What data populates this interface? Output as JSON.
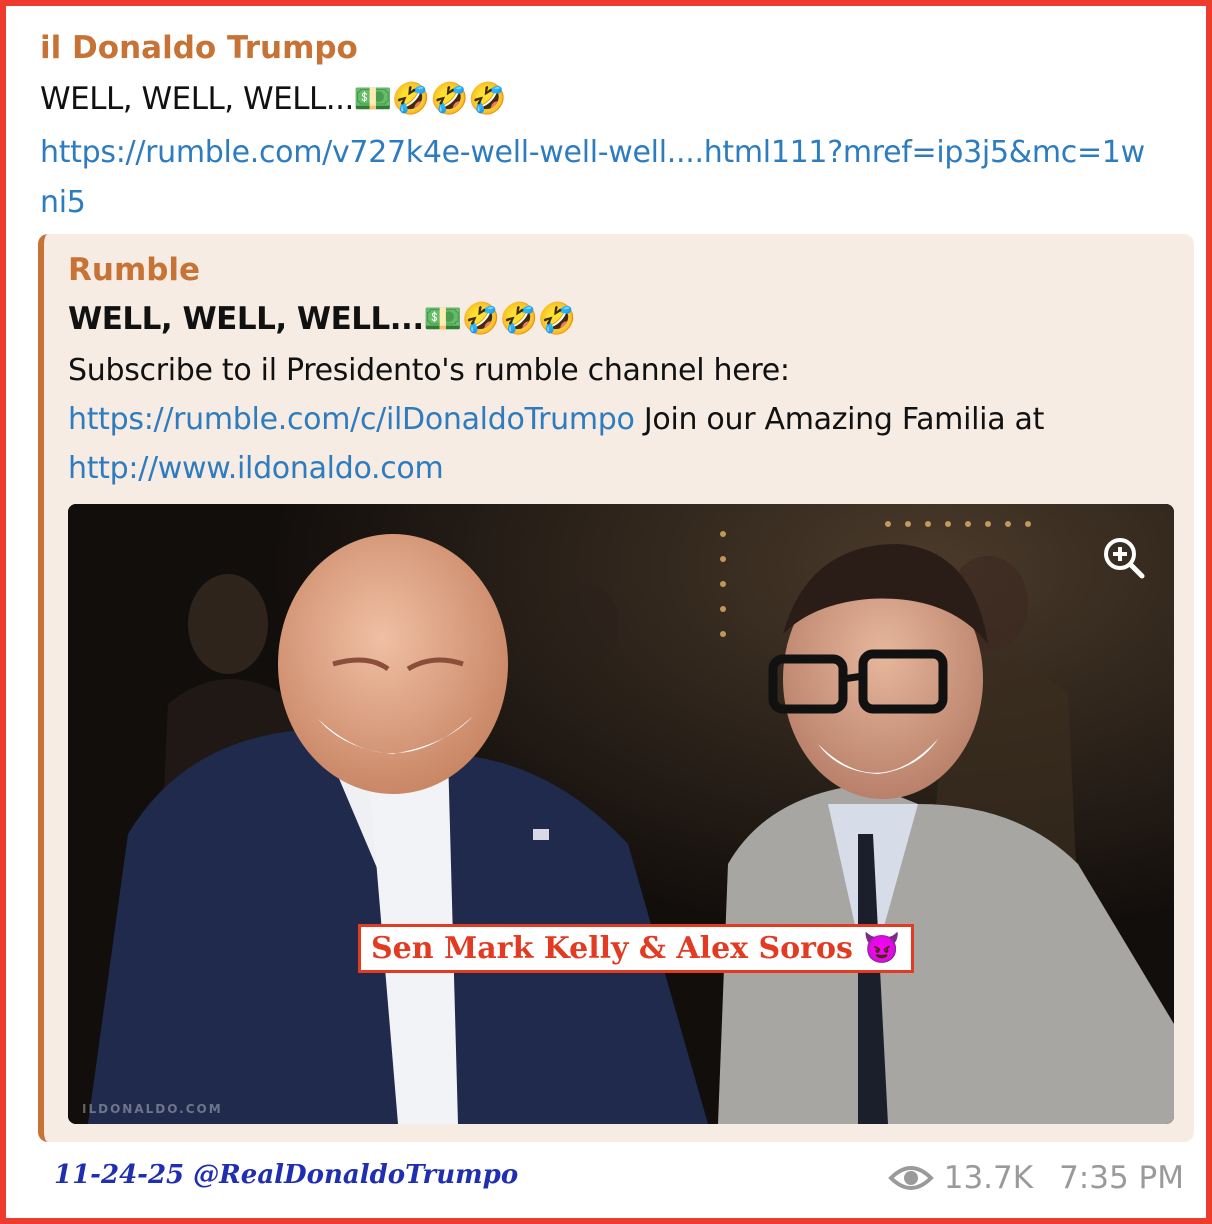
{
  "message": {
    "author": "il Donaldo Trumpo",
    "text": "WELL, WELL, WELL...💵🤣🤣🤣",
    "link": "https://rumble.com/v727k4e-well-well-well....html111?mref=ip3j5&mc=1wni5"
  },
  "preview": {
    "site_name": "Rumble",
    "title": "WELL, WELL, WELL...💵🤣🤣🤣",
    "desc_intro": "Subscribe to il Presidento's rumble channel here: ",
    "desc_link1": "https://rumble.com/c/ilDonaldoTrumpo",
    "desc_middle": " Join our Amazing Familia at ",
    "desc_link2": "http://www.ildonaldo.com",
    "watermark": "ILDONALDO.COM",
    "caption": "Sen Mark Kelly & Alex Soros ",
    "caption_emoji": "😈",
    "zoom_icon": "zoom-in-icon"
  },
  "footer": {
    "signature": "11-24-25 @RealDonaldoTrumpo",
    "views": "13.7K",
    "time": "7:35 PM",
    "views_icon": "eye-icon"
  },
  "colors": {
    "frame": "#ef3b2d",
    "accent": "#c77336",
    "link": "#2e7cc0",
    "preview_bg": "#f6ece4",
    "caption": "#e23b22",
    "signature": "#1f2fb0",
    "meta": "#9a9a9a"
  }
}
